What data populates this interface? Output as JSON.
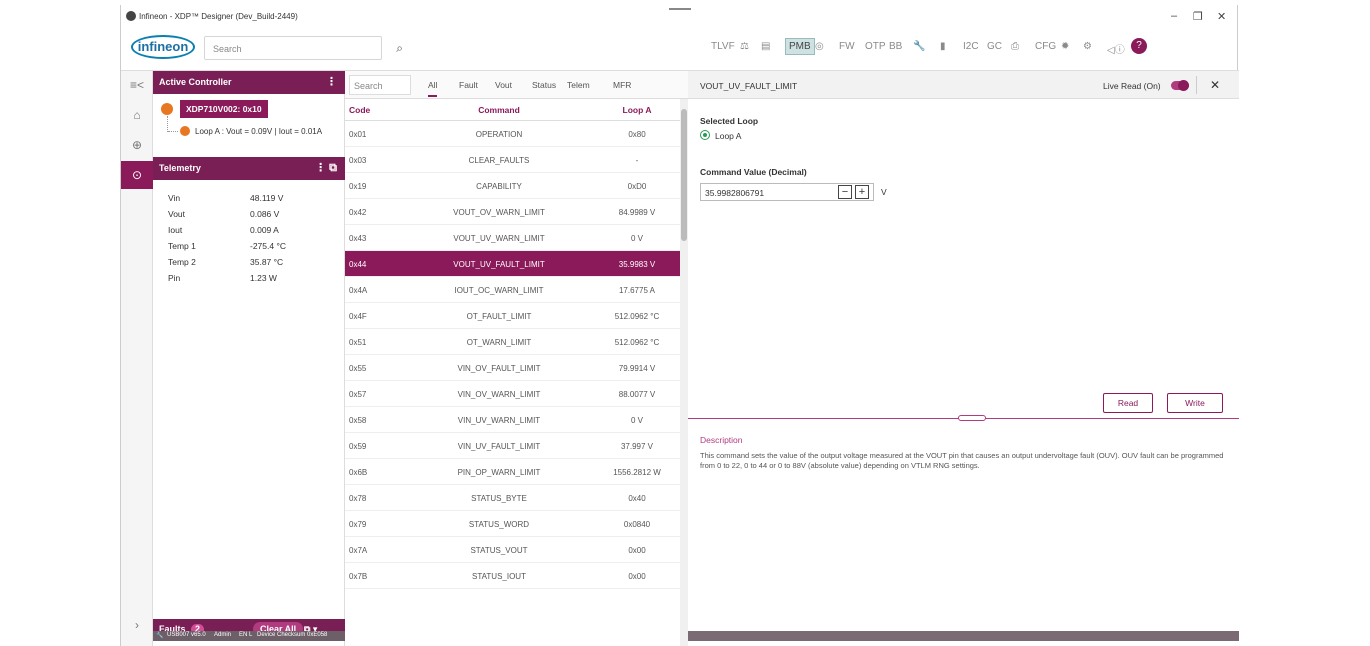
{
  "window": {
    "title": "Infineon - XDP™ Designer (Dev_Build-2449)",
    "controls": {
      "minimize": "–",
      "maximize": "❐",
      "close": "✕"
    }
  },
  "toolbar": {
    "brand": "infineon",
    "search_placeholder": "Search",
    "buttons": [
      "TLVF",
      "⚖",
      "▤",
      "PMB",
      "◎",
      "FW",
      "OTP",
      "BB",
      "🔧",
      "▮",
      "I2C",
      "GC",
      "⎙",
      "CFG",
      "✹",
      "⚙",
      "◁ⓘ",
      "?"
    ]
  },
  "nav": {
    "icons": [
      "≡<",
      "⌂",
      "⊕",
      "⊙",
      "›"
    ]
  },
  "active_controller": {
    "header": "Active Controller",
    "device": "XDP710V002: 0x10",
    "loop_text": "Loop A : Vout = 0.09V | Iout = 0.01A"
  },
  "telemetry": {
    "header": "Telemetry",
    "rows": [
      {
        "label": "Vin",
        "value": "48.119 V"
      },
      {
        "label": "Vout",
        "value": "0.086 V"
      },
      {
        "label": "Iout",
        "value": "0.009 A"
      },
      {
        "label": "Temp 1",
        "value": "-275.4 °C"
      },
      {
        "label": "Temp 2",
        "value": "35.87 °C"
      },
      {
        "label": "Pin",
        "value": "1.23 W"
      }
    ]
  },
  "faults": {
    "label": "Faults",
    "count": "2",
    "clear_label": "Clear All"
  },
  "statusbar": {
    "port": "USB007 v65.0",
    "user": "Admin",
    "lang": "EN L",
    "checksum": "Device Checksum 0xE058"
  },
  "commands": {
    "search_placeholder": "Search",
    "tabs": [
      "All",
      "Fault",
      "Vout",
      "Status",
      "Telem",
      "MFR"
    ],
    "columns": {
      "code": "Code",
      "command": "Command",
      "loop": "Loop A"
    },
    "rows": [
      {
        "code": "0x01",
        "command": "OPERATION",
        "value": "0x80"
      },
      {
        "code": "0x03",
        "command": "CLEAR_FAULTS",
        "value": "-"
      },
      {
        "code": "0x19",
        "command": "CAPABILITY",
        "value": "0xD0"
      },
      {
        "code": "0x42",
        "command": "VOUT_OV_WARN_LIMIT",
        "value": "84.9989 V"
      },
      {
        "code": "0x43",
        "command": "VOUT_UV_WARN_LIMIT",
        "value": "0 V"
      },
      {
        "code": "0x44",
        "command": "VOUT_UV_FAULT_LIMIT",
        "value": "35.9983 V"
      },
      {
        "code": "0x4A",
        "command": "IOUT_OC_WARN_LIMIT",
        "value": "17.6775 A"
      },
      {
        "code": "0x4F",
        "command": "OT_FAULT_LIMIT",
        "value": "512.0962 °C"
      },
      {
        "code": "0x51",
        "command": "OT_WARN_LIMIT",
        "value": "512.0962 °C"
      },
      {
        "code": "0x55",
        "command": "VIN_OV_FAULT_LIMIT",
        "value": "79.9914 V"
      },
      {
        "code": "0x57",
        "command": "VIN_OV_WARN_LIMIT",
        "value": "88.0077 V"
      },
      {
        "code": "0x58",
        "command": "VIN_UV_WARN_LIMIT",
        "value": "0 V"
      },
      {
        "code": "0x59",
        "command": "VIN_UV_FAULT_LIMIT",
        "value": "37.997 V"
      },
      {
        "code": "0x6B",
        "command": "PIN_OP_WARN_LIMIT",
        "value": "1556.2812 W"
      },
      {
        "code": "0x78",
        "command": "STATUS_BYTE",
        "value": "0x40"
      },
      {
        "code": "0x79",
        "command": "STATUS_WORD",
        "value": "0x0840"
      },
      {
        "code": "0x7A",
        "command": "STATUS_VOUT",
        "value": "0x00"
      },
      {
        "code": "0x7B",
        "command": "STATUS_IOUT",
        "value": "0x00"
      }
    ],
    "selected_index": 5
  },
  "detail": {
    "title": "VOUT_UV_FAULT_LIMIT",
    "live_read": "Live Read (On)",
    "close": "✕",
    "selected_loop_label": "Selected Loop",
    "loop_option": "Loop A",
    "value_label": "Command Value (Decimal)",
    "value": "35.9982806791",
    "unit": "V",
    "read_label": "Read",
    "write_label": "Write",
    "description_label": "Description",
    "description": "This command sets the value of the output voltage measured at the VOUT pin that causes an output undervoltage fault (OUV). OUV fault can be programmed from 0 to 22, 0 to 44 or 0 to 88V (absolute value) depending on VTLM RNG settings."
  }
}
